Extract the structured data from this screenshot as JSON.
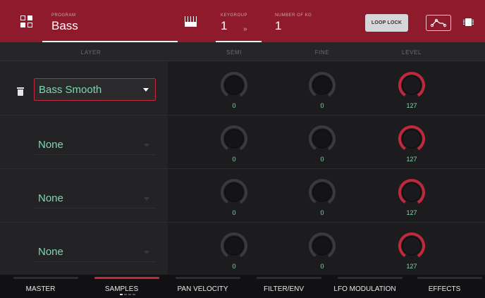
{
  "header": {
    "program_label": "PROGRAM",
    "program_value": "Bass",
    "keygroup_label": "KEYGROUP",
    "keygroup_value": "1",
    "keygroup_separator": "»",
    "num_keygroups_label": "NUMBER OF KG",
    "num_keygroups_value": "1",
    "loop_lock_label": "LOOP LOCK"
  },
  "columns": {
    "layer": "LAYER",
    "semi": "SEMI",
    "fine": "FINE",
    "level": "LEVEL"
  },
  "layers": [
    {
      "sample": "Bass Smooth",
      "semi": "0",
      "fine": "0",
      "level": "127"
    },
    {
      "sample": "None",
      "semi": "0",
      "fine": "0",
      "level": "127"
    },
    {
      "sample": "None",
      "semi": "0",
      "fine": "0",
      "level": "127"
    },
    {
      "sample": "None",
      "semi": "0",
      "fine": "0",
      "level": "127"
    }
  ],
  "tabs": [
    {
      "label": "MASTER",
      "active": false
    },
    {
      "label": "SAMPLES",
      "active": true
    },
    {
      "label": "PAN VELOCITY",
      "active": false
    },
    {
      "label": "FILTER/ENV",
      "active": false
    },
    {
      "label": "LFO MODULATION",
      "active": false
    },
    {
      "label": "EFFECTS",
      "active": false
    }
  ],
  "samples_page_indicator": {
    "page": 1,
    "pages": 4
  },
  "icons": {
    "program_grid": "grid-icon",
    "keyboard": "keyboard-icon",
    "envelope": "envelope-icon",
    "chip": "chip-icon",
    "delete": "trash-icon"
  },
  "colors": {
    "header_bg": "#8e1a2c",
    "accent": "#c0283c",
    "value_text": "#7fd7b0"
  }
}
